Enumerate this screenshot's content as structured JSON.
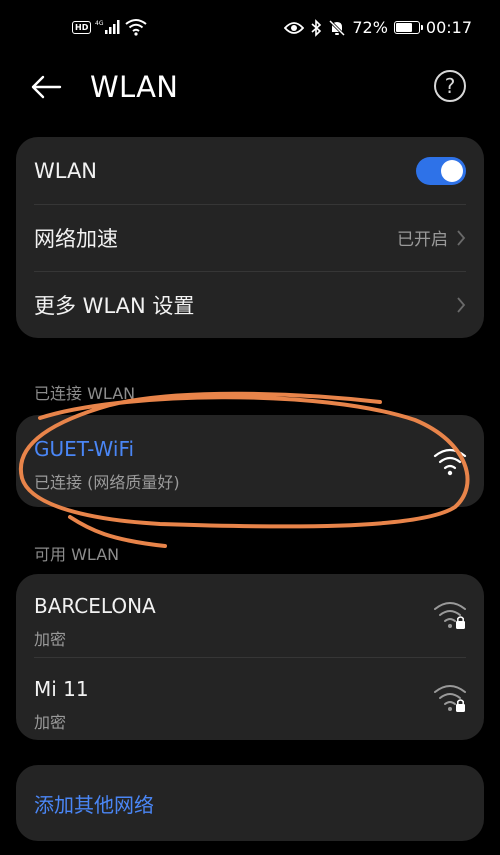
{
  "status_bar": {
    "hd_badge": "HD",
    "network_type": "4G",
    "battery_percent": "72%",
    "battery_level": 0.72,
    "time": "00:17",
    "icons": [
      "eye-icon",
      "bluetooth-icon",
      "mute-icon"
    ]
  },
  "header": {
    "title": "WLAN",
    "help_glyph": "?"
  },
  "settings": {
    "wlan_label": "WLAN",
    "wlan_enabled": true,
    "accel_label": "网络加速",
    "accel_value": "已开启",
    "more_label": "更多 WLAN 设置"
  },
  "connected_section": {
    "label": "已连接 WLAN",
    "network": {
      "name": "GUET-WiFi",
      "status": "已连接 (网络质量好)"
    }
  },
  "available_section": {
    "label": "可用 WLAN",
    "networks": [
      {
        "name": "BARCELONA",
        "status": "加密"
      },
      {
        "name": "Mi 11",
        "status": "加密"
      }
    ]
  },
  "add_network_label": "添加其他网络",
  "colors": {
    "accent": "#4a86f5",
    "toggle_on": "#2e72e8",
    "card_bg": "#242424",
    "annotation": "#e8844a"
  }
}
